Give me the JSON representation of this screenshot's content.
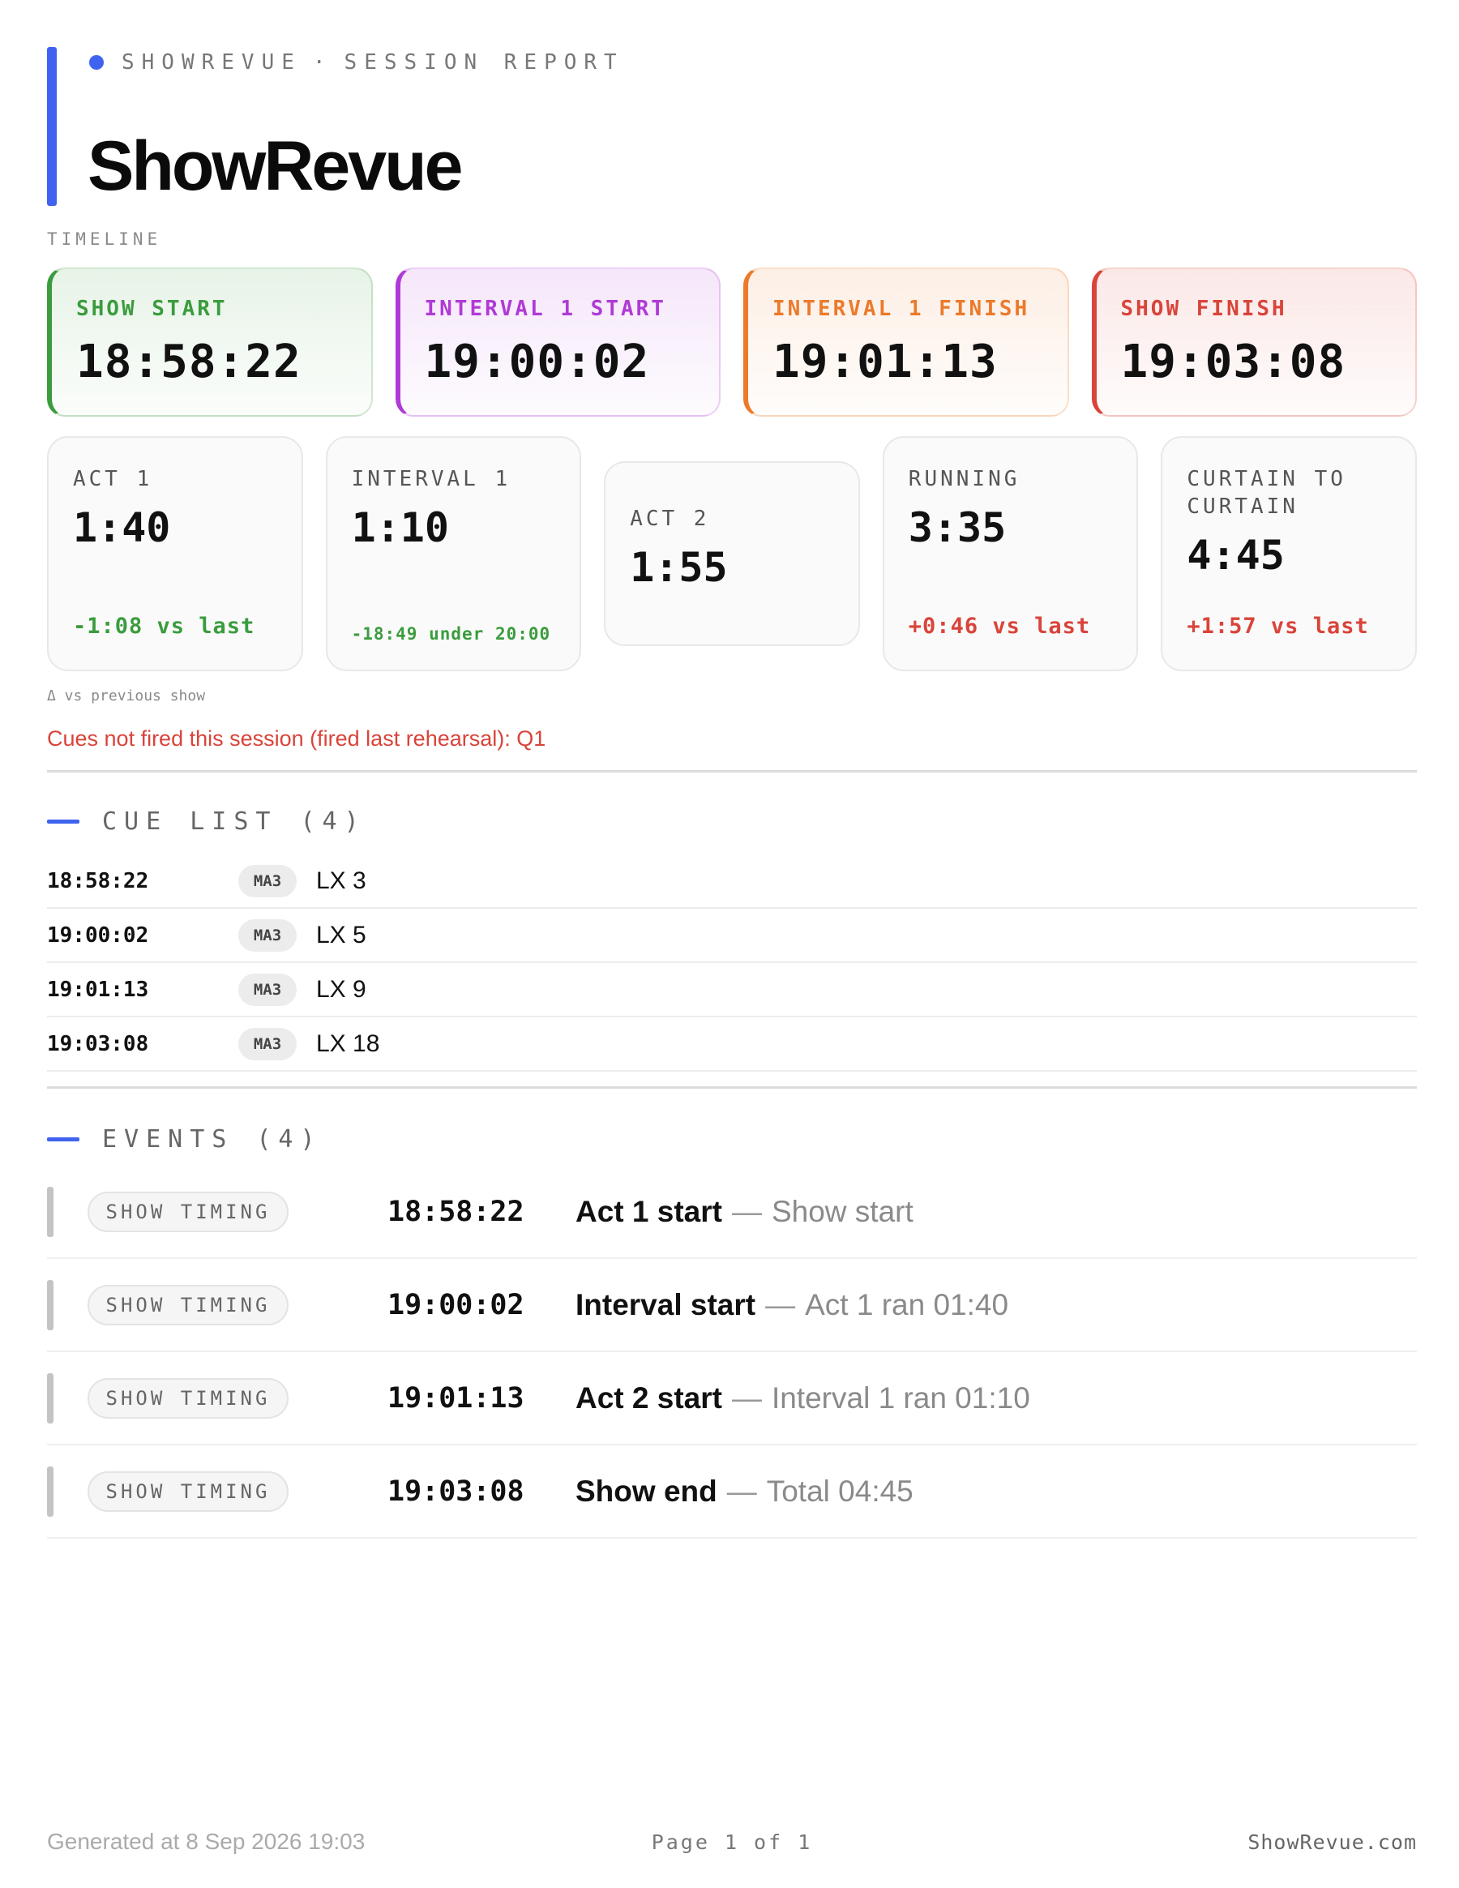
{
  "header": {
    "brand": "SHOWREVUE",
    "separator": "·",
    "report_type": "SESSION REPORT",
    "title": "ShowRevue",
    "accent_color": "#3f63f0"
  },
  "timeline": {
    "label": "TIMELINE",
    "cards": [
      {
        "label": "SHOW START",
        "value": "18:58:22",
        "color": "#3b9c3e"
      },
      {
        "label": "INTERVAL 1 START",
        "value": "19:00:02",
        "color": "#b03ad6"
      },
      {
        "label": "INTERVAL 1 FINISH",
        "value": "19:01:13",
        "color": "#ec7a2a"
      },
      {
        "label": "SHOW FINISH",
        "value": "19:03:08",
        "color": "#d9443a"
      }
    ]
  },
  "durations": [
    {
      "label": "ACT 1",
      "value": "1:40",
      "delta": "-1:08 vs last",
      "delta_color": "green"
    },
    {
      "label": "INTERVAL 1",
      "value": "1:10",
      "delta": "-18:49 under 20:00",
      "delta_color": "green"
    },
    {
      "label": "ACT 2",
      "value": "1:55",
      "delta": "",
      "delta_color": ""
    },
    {
      "label": "RUNNING",
      "value": "3:35",
      "delta": "+0:46 vs last",
      "delta_color": "red"
    },
    {
      "label": "CURTAIN TO CURTAIN",
      "value": "4:45",
      "delta": "+1:57 vs last",
      "delta_color": "red"
    }
  ],
  "delta_note": "Δ vs previous show",
  "cues_warning": "Cues not fired this session (fired last rehearsal): Q1",
  "cue_list": {
    "heading": "CUE LIST",
    "count": "(4)",
    "rows": [
      {
        "time": "18:58:22",
        "console": "MA3",
        "cue": "LX 3"
      },
      {
        "time": "19:00:02",
        "console": "MA3",
        "cue": "LX 5"
      },
      {
        "time": "19:01:13",
        "console": "MA3",
        "cue": "LX 9"
      },
      {
        "time": "19:03:08",
        "console": "MA3",
        "cue": "LX 18"
      }
    ]
  },
  "events": {
    "heading": "EVENTS",
    "count": "(4)",
    "rows": [
      {
        "tag": "SHOW TIMING",
        "time": "18:58:22",
        "title": "Act 1 start",
        "sep": "—",
        "detail": "Show start"
      },
      {
        "tag": "SHOW TIMING",
        "time": "19:00:02",
        "title": "Interval start",
        "sep": "—",
        "detail": "Act 1 ran 01:40"
      },
      {
        "tag": "SHOW TIMING",
        "time": "19:01:13",
        "title": "Act 2 start",
        "sep": "—",
        "detail": "Interval 1 ran 01:10"
      },
      {
        "tag": "SHOW TIMING",
        "time": "19:03:08",
        "title": "Show end",
        "sep": "—",
        "detail": "Total 04:45"
      }
    ]
  },
  "footer": {
    "generated": "Generated at 8 Sep 2026 19:03",
    "page": "Page 1 of 1",
    "site": "ShowRevue.com"
  }
}
